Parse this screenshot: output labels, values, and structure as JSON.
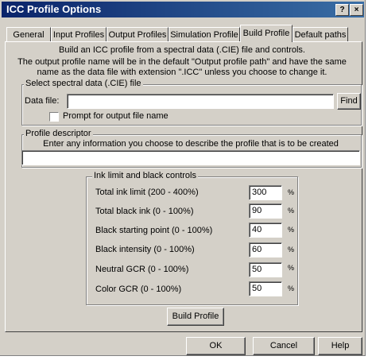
{
  "window": {
    "title": "ICC Profile Options",
    "help_glyph": "?",
    "close_glyph": "×"
  },
  "tabs": [
    {
      "label": "General"
    },
    {
      "label": "Input Profiles"
    },
    {
      "label": "Output Profiles"
    },
    {
      "label": "Simulation Profile"
    },
    {
      "label": "Build Profile",
      "active": true
    },
    {
      "label": "Default paths"
    }
  ],
  "intro": {
    "line1": "Build an ICC profile from a spectral data (.CIE) file and controls.",
    "line2": "The output profile name will be in the default \"Output profile path\" and have the same",
    "line3": "name as the data file with extension \".ICC\" unless you choose to change it."
  },
  "spectral": {
    "group_label": "Select spectral data (.CIE) file",
    "data_file_label": "Data file:",
    "data_file_value": "",
    "find_label": "Find",
    "prompt_label": "Prompt for output file name",
    "prompt_checked": false
  },
  "descriptor": {
    "group_label": "Profile descriptor",
    "hint": "Enter any information you choose to describe the profile that is to be created",
    "value": ""
  },
  "ink": {
    "group_label": "Ink limit and black controls",
    "unit": "%",
    "rows": [
      {
        "label": "Total ink limit (200 - 400%)",
        "value": "300"
      },
      {
        "label": "Total black ink (0 - 100%)",
        "value": "90"
      },
      {
        "label": "Black starting point (0 - 100%)",
        "value": "40"
      },
      {
        "label": "Black intensity (0 - 100%)",
        "value": "60"
      },
      {
        "label": "Neutral GCR (0 - 100%)",
        "value": "50"
      },
      {
        "label": "Color GCR (0 - 100%)",
        "value": "50"
      }
    ]
  },
  "build_button": "Build Profile",
  "footer": {
    "ok": "OK",
    "cancel": "Cancel",
    "help": "Help"
  }
}
